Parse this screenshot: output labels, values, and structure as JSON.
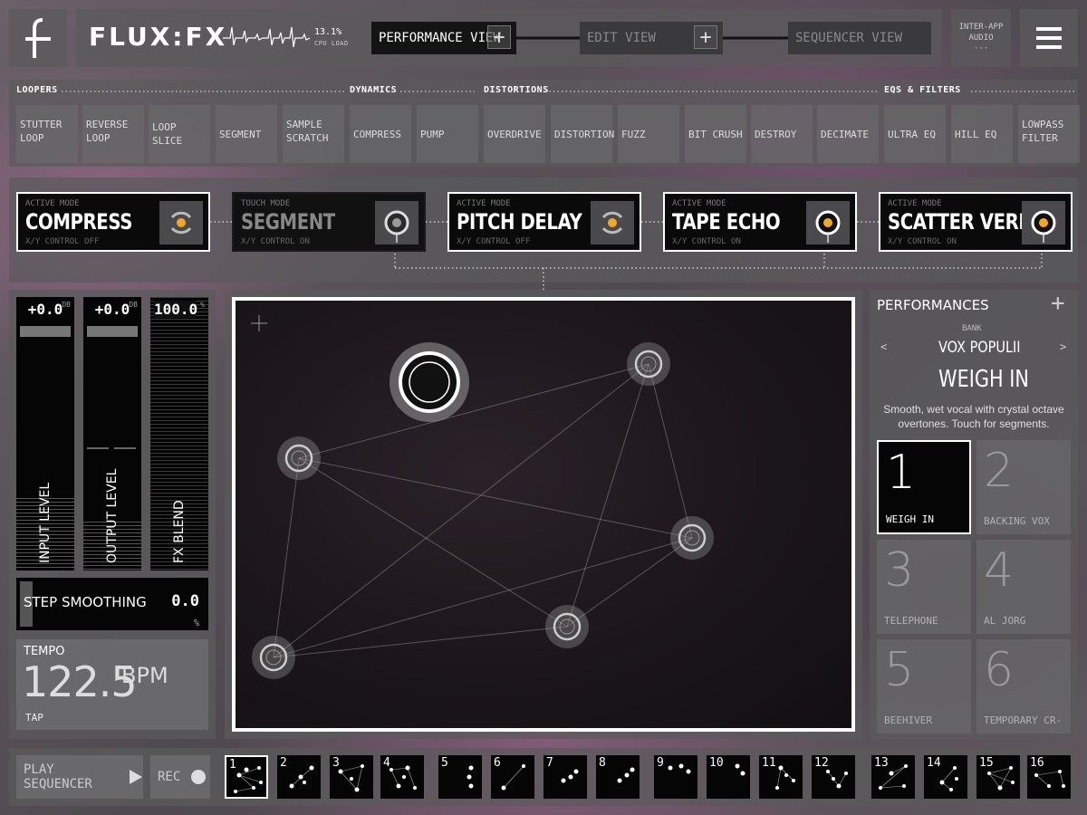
{
  "header": {
    "title": "FLUX:FX",
    "cpu_value": "13.1%",
    "cpu_label": "CPU LOAD",
    "tabs": [
      {
        "label": "PERFORMANCE VIEW",
        "plus": "+"
      },
      {
        "label": "EDIT VIEW",
        "plus": "+"
      },
      {
        "label": "SEQUENCER VIEW"
      }
    ],
    "iaa_line1": "INTER-APP",
    "iaa_line2": "AUDIO",
    "iaa_dots": "···"
  },
  "categories": [
    "LOOPERS",
    "DYNAMICS",
    "DISTORTIONS",
    "EQS & FILTERS"
  ],
  "effects": [
    {
      "l1": "STUTTER",
      "l2": "LOOP"
    },
    {
      "l1": "REVERSE",
      "l2": "LOOP"
    },
    {
      "l1": "LOOP SLICE",
      "l2": ""
    },
    {
      "l1": "SEGMENT",
      "l2": ""
    },
    {
      "l1": "SAMPLE",
      "l2": "SCRATCH"
    },
    {
      "l1": "COMPRESS",
      "l2": ""
    },
    {
      "l1": "PUMP",
      "l2": ""
    },
    {
      "l1": "OVERDRIVE",
      "l2": ""
    },
    {
      "l1": "DISTORTION",
      "l2": ""
    },
    {
      "l1": "FUZZ",
      "l2": ""
    },
    {
      "l1": "BIT CRUSH",
      "l2": ""
    },
    {
      "l1": "DESTROY",
      "l2": ""
    },
    {
      "l1": "DECIMATE",
      "l2": ""
    },
    {
      "l1": "ULTRA EQ",
      "l2": ""
    },
    {
      "l1": "HILL EQ",
      "l2": ""
    },
    {
      "l1": "LOWPASS",
      "l2": "FILTER"
    }
  ],
  "slots": [
    {
      "mode": "ACTIVE MODE",
      "name": "COMPRESS",
      "xy": "X/Y CONTROL OFF"
    },
    {
      "mode": "TOUCH MODE",
      "name": "SEGMENT",
      "xy": "X/Y CONTROL ON"
    },
    {
      "mode": "ACTIVE MODE",
      "name": "PITCH DELAY",
      "xy": "X/Y CONTROL OFF"
    },
    {
      "mode": "ACTIVE MODE",
      "name": "TAPE ECHO",
      "xy": "X/Y CONTROL ON"
    },
    {
      "mode": "ACTIVE MODE",
      "name": "SCATTER VERB",
      "xy": "X/Y CONTROL ON"
    }
  ],
  "meters": {
    "input": {
      "value": "+0.0",
      "unit": "DB",
      "label": "INPUT LEVEL"
    },
    "output": {
      "value": "+0.0",
      "unit": "DB",
      "label": "OUTPUT LEVEL"
    },
    "blend": {
      "value": "100.0",
      "unit": "%",
      "label": "FX BLEND"
    }
  },
  "step_smoothing": {
    "label": "STEP SMOOTHING",
    "value": "0.0",
    "unit": "%"
  },
  "tempo": {
    "label": "TEMPO",
    "value": "122.5",
    "unit": "BPM",
    "tap": "TAP"
  },
  "performances": {
    "title": "PERFORMANCES",
    "plus": "+",
    "bank_label": "BANK",
    "bank_name": "VOX POPULII",
    "prev": "<",
    "next": ">",
    "name": "WEIGH IN",
    "description": "Smooth, wet vocal with crystal octave overtones. Touch for segments.",
    "presets": [
      {
        "num": "1",
        "name": "WEIGH IN"
      },
      {
        "num": "2",
        "name": "BACKING VOX"
      },
      {
        "num": "3",
        "name": "TELEPHONE"
      },
      {
        "num": "4",
        "name": "AL JORG"
      },
      {
        "num": "5",
        "name": "BEEHIVER"
      },
      {
        "num": "6",
        "name": "TEMPORARY CR-"
      }
    ]
  },
  "bottom": {
    "play_label": "PLAY SEQUENCER",
    "rec_label": "REC",
    "segments": [
      "1",
      "2",
      "3",
      "4",
      "5",
      "6",
      "7",
      "8",
      "9",
      "10",
      "11",
      "12",
      "13",
      "14",
      "15",
      "16"
    ]
  },
  "colors": {
    "accent": "#f5a623",
    "selected_border": "#ffffff"
  }
}
